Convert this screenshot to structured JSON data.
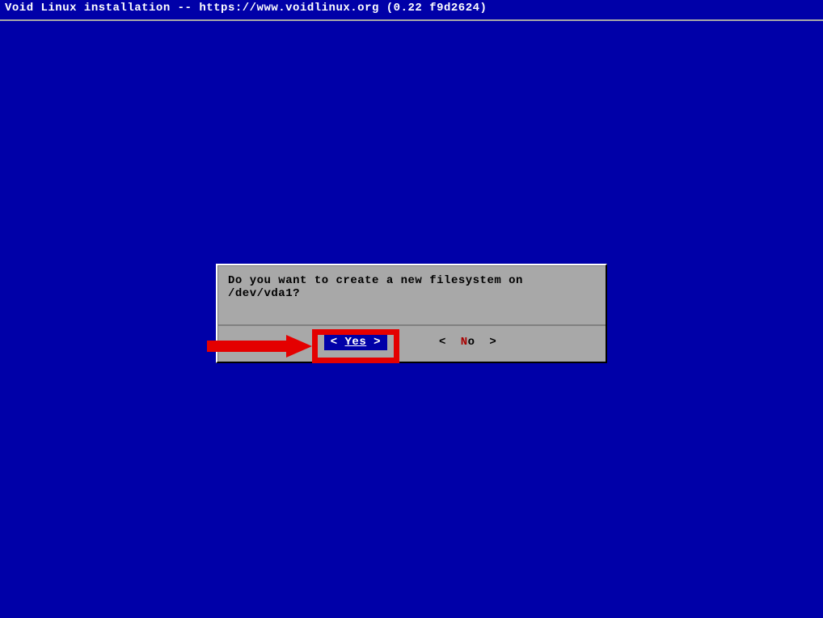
{
  "header": {
    "title": "Void Linux installation -- https://www.voidlinux.org (0.22 f9d2624)"
  },
  "dialog": {
    "message": "Do you want to create a new filesystem on /dev/vda1?",
    "yes_label": "Yes",
    "no_prefix": "N",
    "no_suffix": "o"
  }
}
